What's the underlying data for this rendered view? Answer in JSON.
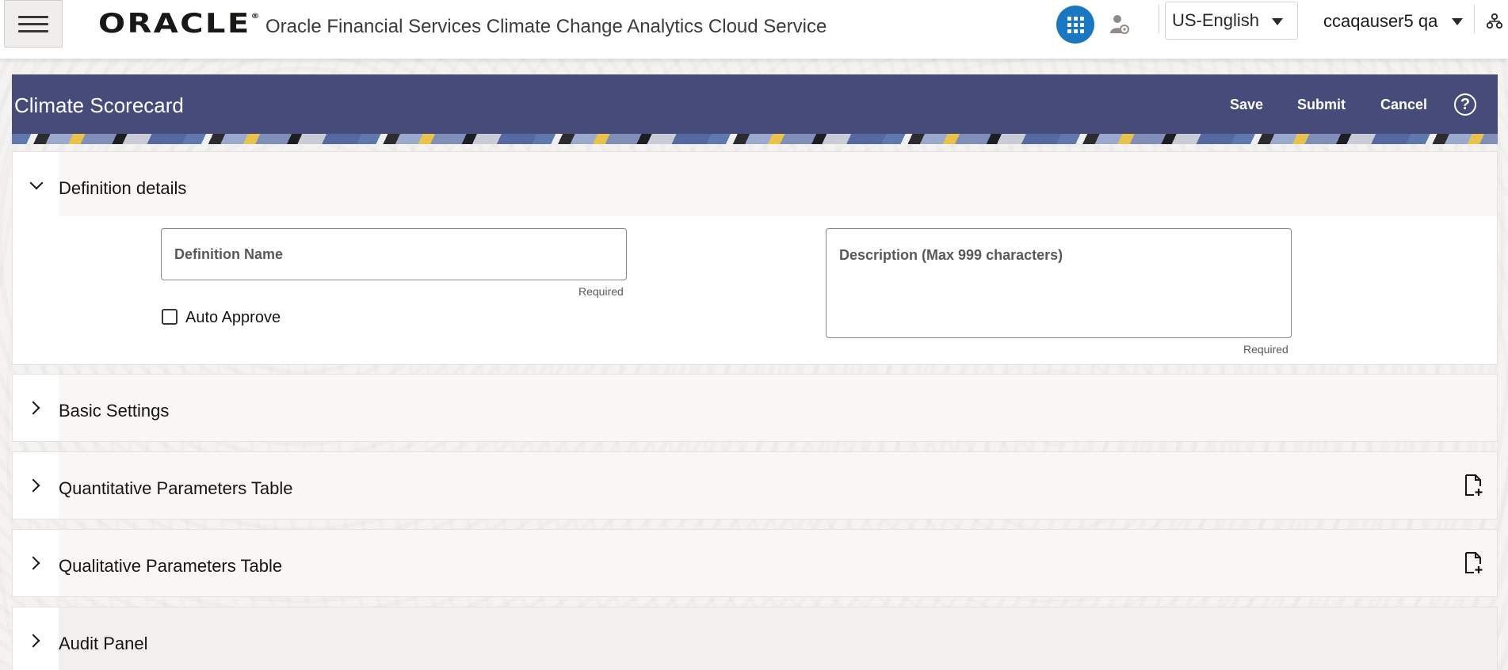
{
  "header": {
    "brand": "ORACLE",
    "brand_mark": "®",
    "app_title": "Oracle Financial Services Climate Change Analytics Cloud Service",
    "language": "US-English",
    "user": "ccaqauser5 qa"
  },
  "page": {
    "title": "Climate Scorecard",
    "actions": {
      "save": "Save",
      "submit": "Submit",
      "cancel": "Cancel",
      "help": "?"
    }
  },
  "definition_details": {
    "title": "Definition details",
    "name_placeholder": "Definition Name",
    "name_required": "Required",
    "auto_approve_label": "Auto Approve",
    "auto_approve_checked": false,
    "description_placeholder": "Description (Max 999 characters)",
    "description_required": "Required"
  },
  "sections": {
    "basic_settings": "Basic Settings",
    "quantitative": "Quantitative Parameters Table",
    "qualitative": "Qualitative Parameters Table",
    "audit": "Audit Panel"
  },
  "colors": {
    "page_header_bg": "#474b7a",
    "apps_button": "#1a78c2"
  },
  "icons": [
    "hamburger-menu-icon",
    "apps-grid-icon",
    "user-settings-icon",
    "organization-icon",
    "help-icon",
    "chevron-down-icon",
    "chevron-right-icon",
    "add-document-icon"
  ]
}
